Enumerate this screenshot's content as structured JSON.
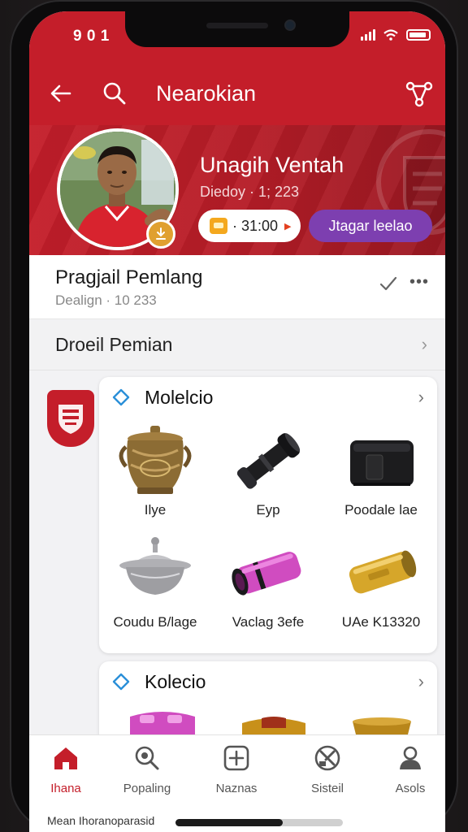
{
  "status": {
    "time": "9 0 1"
  },
  "header": {
    "title": "Nearokian"
  },
  "profile": {
    "name": "Unagih Ventah",
    "date": "Diedoy · 1; 223",
    "coins": "· 31:00",
    "action_label": "Jtagar leelao"
  },
  "info": {
    "title": "Pragjail Pemlang",
    "subtitle": "Dealign · 10 233"
  },
  "section": {
    "label": "Droeil Pemian"
  },
  "collections": [
    {
      "title": "Molelcio",
      "items": [
        {
          "label": "Ilye",
          "icon": "ornate-bronze-pot-icon"
        },
        {
          "label": "Eyp",
          "icon": "black-telescope-tube-icon"
        },
        {
          "label": "Poodale lae",
          "icon": "black-leather-case-icon"
        },
        {
          "label": "Coudu B/lage",
          "icon": "silver-lidded-pot-icon"
        },
        {
          "label": "Vaclag 3efe",
          "icon": "pink-canister-icon"
        },
        {
          "label": "UAe K13320",
          "icon": "gold-canister-icon"
        }
      ]
    },
    {
      "title": "Kolecio",
      "items": []
    }
  ],
  "tabs": [
    {
      "label": "Ihana",
      "icon": "home-icon",
      "active": true
    },
    {
      "label": "Popaling",
      "icon": "search-icon",
      "active": false
    },
    {
      "label": "Naznas",
      "icon": "add-icon",
      "active": false
    },
    {
      "label": "Sisteil",
      "icon": "tools-icon",
      "active": false
    },
    {
      "label": "Asols",
      "icon": "person-icon",
      "active": false
    }
  ],
  "footer": {
    "text": "Mean Ihoranoparasid"
  },
  "colors": {
    "primary": "#c41e2a",
    "accent_purple": "#7d3fb0",
    "coin": "#f4a81e"
  }
}
